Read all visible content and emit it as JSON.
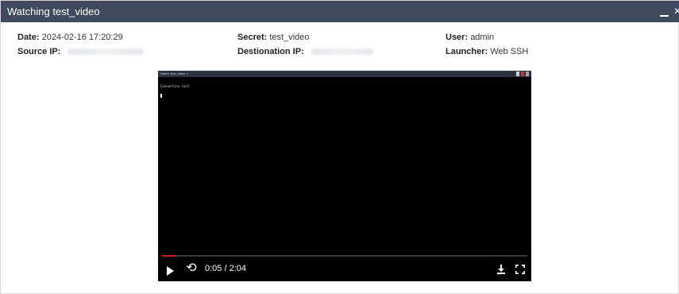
{
  "window": {
    "title": "Watching test_video",
    "minimize_icon": "minimize-icon",
    "close_icon": "close-icon",
    "close_glyph": "✕"
  },
  "details": {
    "date_label": "Date:",
    "date_value": "2024-02-16 17:20:29",
    "source_ip_label": "Source IP:",
    "secret_label": "Secret:",
    "secret_value": "test_video",
    "destination_ip_label": "Destionation IP:",
    "user_label": "User:",
    "user_value": "admin",
    "launcher_label": "Launcher:",
    "launcher_value": "Web SSH"
  },
  "terminal": {
    "title": "Xterm: test_video ✓",
    "output_line": "Connection lost."
  },
  "player": {
    "time_display": "0:05 / 2:04",
    "progress_fraction": 0.04,
    "play_icon": "play-icon",
    "loop_icon": "loop-icon",
    "loop_glyph": "⟲",
    "download_icon": "download-icon",
    "fullscreen_icon": "fullscreen-icon",
    "progress_color": "#d0211c"
  },
  "colors": {
    "titlebar": "#3f4a5e",
    "player_background": "#000000"
  }
}
